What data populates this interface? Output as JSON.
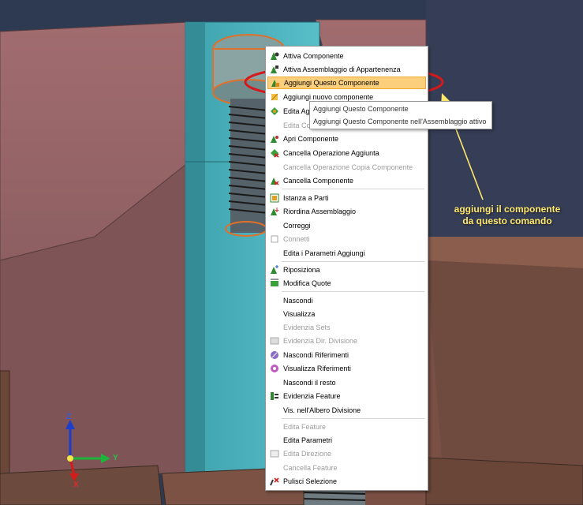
{
  "context_menu": {
    "items": [
      {
        "label": "Attiva Componente",
        "icon": "activate-component-icon",
        "enabled": true
      },
      {
        "label": "Attiva Assemblaggio di Appartenenza",
        "icon": "activate-parent-assembly-icon",
        "enabled": true
      },
      {
        "label": "Aggiungi Questo Componente",
        "icon": "add-component-icon",
        "enabled": true,
        "highlighted": true
      },
      {
        "label": "Aggiungi nuovo componente",
        "icon": "new-component-icon",
        "enabled": true
      },
      {
        "label": "Edita Agg",
        "icon": "edit-add-icon",
        "enabled": true
      },
      {
        "label": "Edita Cop",
        "icon": "",
        "enabled": false
      },
      {
        "label": "Apri Componente",
        "icon": "open-component-icon",
        "enabled": true
      },
      {
        "label": "Cancella Operazione Aggiunta",
        "icon": "cancel-add-icon",
        "enabled": true
      },
      {
        "label": "Cancella Operazione Copia Componente",
        "icon": "",
        "enabled": false
      },
      {
        "label": "Cancella Componente",
        "icon": "delete-component-icon",
        "enabled": true
      },
      {
        "label": "Istanza a Parti",
        "icon": "instance-to-parts-icon",
        "enabled": true
      },
      {
        "label": "Riordina Assemblaggio",
        "icon": "reorder-assembly-icon",
        "enabled": true
      },
      {
        "label": "Correggi",
        "icon": "",
        "enabled": true
      },
      {
        "label": "Connetti",
        "icon": "connect-icon",
        "enabled": false
      },
      {
        "label": "Edita i Parametri Aggiungi",
        "icon": "",
        "enabled": true
      },
      {
        "label": "Riposiziona",
        "icon": "reposition-icon",
        "enabled": true
      },
      {
        "label": "Modifica Quote",
        "icon": "modify-dimensions-icon",
        "enabled": true
      },
      {
        "label": "Nascondi",
        "icon": "",
        "enabled": true
      },
      {
        "label": "Visualizza",
        "icon": "",
        "enabled": true
      },
      {
        "label": "Evidenzia Sets",
        "icon": "",
        "enabled": false
      },
      {
        "label": "Evidenzia Dir. Divisione",
        "icon": "split-direction-icon",
        "enabled": false
      },
      {
        "label": "Nascondi Riferimenti",
        "icon": "hide-references-icon",
        "enabled": true
      },
      {
        "label": "Visualizza Riferimenti",
        "icon": "show-references-icon",
        "enabled": true
      },
      {
        "label": "Nascondi il resto",
        "icon": "",
        "enabled": true
      },
      {
        "label": "Evidenzia Feature",
        "icon": "highlight-feature-icon",
        "enabled": true
      },
      {
        "label": "Vis. nell'Albero Divisione",
        "icon": "",
        "enabled": true
      },
      {
        "label": "Edita Feature",
        "icon": "",
        "enabled": false
      },
      {
        "label": "Edita Parametri",
        "icon": "",
        "enabled": true
      },
      {
        "label": "Edita Direzione",
        "icon": "edit-direction-icon",
        "enabled": false
      },
      {
        "label": "Cancella Feature",
        "icon": "",
        "enabled": false
      },
      {
        "label": "Pulisci Selezione",
        "icon": "clear-selection-icon",
        "enabled": true
      }
    ]
  },
  "submenu": {
    "items": [
      {
        "label": "Aggiungi Questo Componente"
      },
      {
        "label": "Aggiungi Questo Componente nell'Assemblaggio attivo"
      }
    ]
  },
  "annotation": {
    "line1": "aggiungi il componente",
    "line2": "da questo comando"
  },
  "axes": {
    "z": "Z",
    "y": "Y",
    "x": "X"
  },
  "colors": {
    "menu_highlight": "#fbcf7b",
    "annotation_text": "#ffe86a",
    "callout_ellipse": "#d4191d",
    "part_top": "#946266",
    "part_block": "#54b8c2",
    "screw_highlight": "#e0702a",
    "background_dark": "#2e3a52"
  }
}
